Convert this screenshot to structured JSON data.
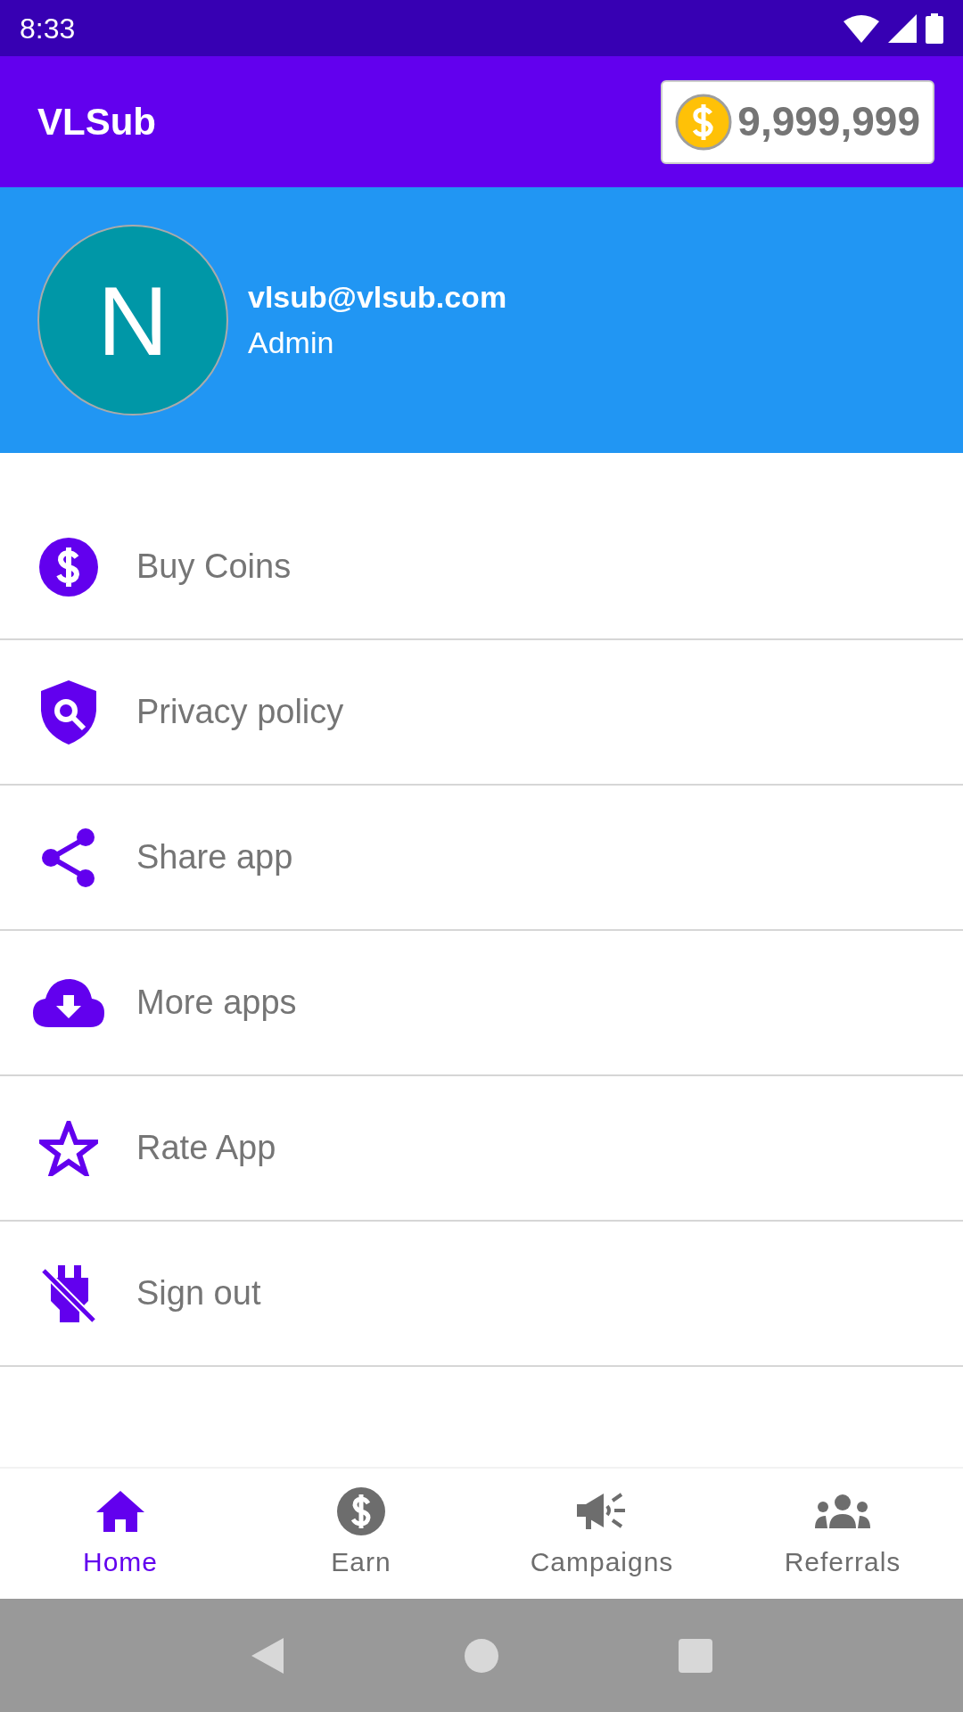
{
  "status_bar": {
    "time": "8:33"
  },
  "app_bar": {
    "title": "VLSub",
    "coins": "9,999,999"
  },
  "profile": {
    "initial": "N",
    "email": "vlsub@vlsub.com",
    "role": "Admin"
  },
  "menu": [
    {
      "label": "Buy Coins"
    },
    {
      "label": "Privacy policy"
    },
    {
      "label": "Share app"
    },
    {
      "label": "More apps"
    },
    {
      "label": "Rate App"
    },
    {
      "label": "Sign out"
    }
  ],
  "bottom_nav": [
    {
      "label": "Home",
      "selected": true
    },
    {
      "label": "Earn",
      "selected": false
    },
    {
      "label": "Campaigns",
      "selected": false
    },
    {
      "label": "Referrals",
      "selected": false
    }
  ]
}
